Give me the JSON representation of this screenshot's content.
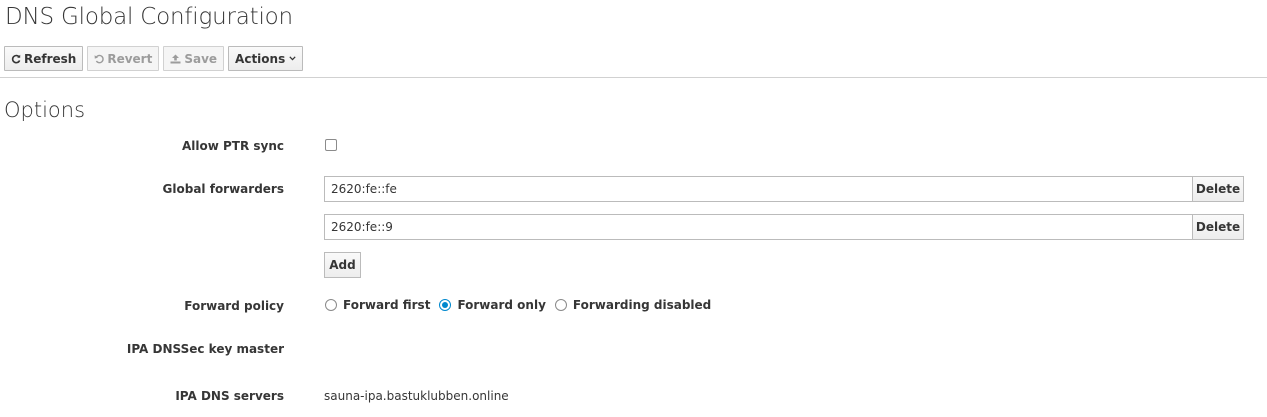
{
  "header": {
    "title": "DNS Global Configuration"
  },
  "toolbar": {
    "refresh_label": "Refresh",
    "revert_label": "Revert",
    "save_label": "Save",
    "actions_label": "Actions"
  },
  "options": {
    "section_title": "Options",
    "allow_ptr_sync": {
      "label": "Allow PTR sync",
      "checked": false
    },
    "global_forwarders": {
      "label": "Global forwarders",
      "items": [
        {
          "value": "2620:fe::fe",
          "delete_label": "Delete"
        },
        {
          "value": "2620:fe::9",
          "delete_label": "Delete"
        }
      ],
      "add_label": "Add"
    },
    "forward_policy": {
      "label": "Forward policy",
      "options": [
        "Forward first",
        "Forward only",
        "Forwarding disabled"
      ],
      "selected": "Forward only"
    },
    "dnssec_key_master": {
      "label": "IPA DNSSec key master",
      "value": ""
    },
    "dns_servers": {
      "label": "IPA DNS servers",
      "value": "sauna-ipa.bastuklubben.online"
    }
  },
  "colors": {
    "accent": "#0088ce",
    "border": "#bbbbbb",
    "text": "#363636"
  }
}
